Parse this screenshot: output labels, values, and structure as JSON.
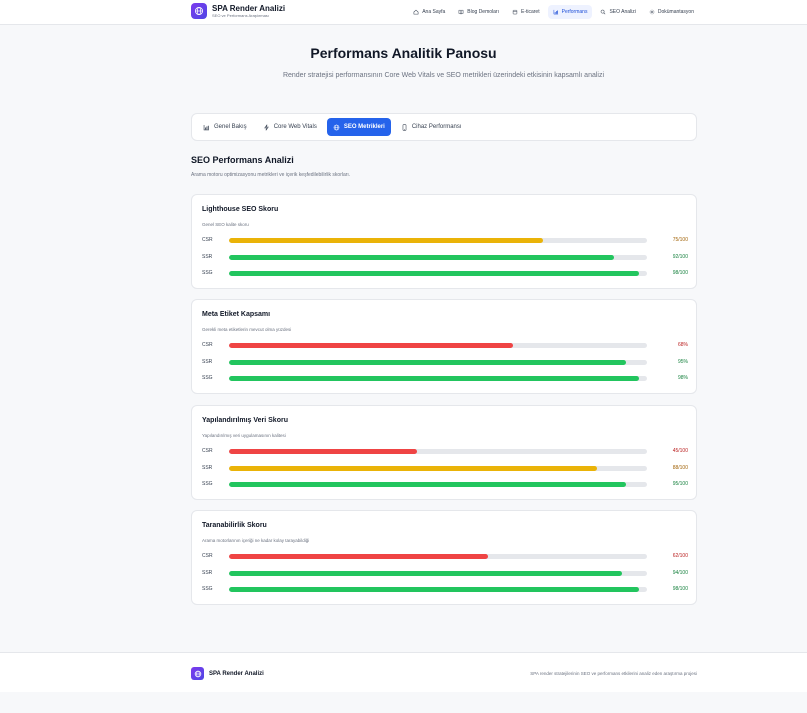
{
  "header": {
    "brand_title": "SPA Render Analizi",
    "brand_subtitle": "SEO ve Performans Araştırması",
    "logo_icon": "globe-icon",
    "nav": [
      {
        "label": "Ana Sayfa",
        "icon": "home-icon",
        "active": false
      },
      {
        "label": "Blog Demoları",
        "icon": "book-icon",
        "active": false
      },
      {
        "label": "E-ticaret",
        "icon": "store-icon",
        "active": false
      },
      {
        "label": "Performans",
        "icon": "chart-icon",
        "active": true
      },
      {
        "label": "SEO Analizi",
        "icon": "search-icon",
        "active": false
      },
      {
        "label": "Dokümantasyon",
        "icon": "gear-icon",
        "active": false
      }
    ]
  },
  "page": {
    "title": "Performans Analitik Panosu",
    "subtitle": "Render stratejisi performansının Core Web Vitals ve SEO metrikleri üzerindeki etkisinin kapsamlı analizi"
  },
  "tabs": [
    {
      "label": "Genel Bakış",
      "icon": "bar-chart-icon",
      "active": false
    },
    {
      "label": "Core Web Vitals",
      "icon": "lightning-icon",
      "active": false
    },
    {
      "label": "SEO Metrikleri",
      "icon": "globe-icon",
      "active": true
    },
    {
      "label": "Cihaz Performansı",
      "icon": "mobile-icon",
      "active": false
    }
  ],
  "section": {
    "title": "SEO Performans Analizi",
    "description": "Arama motoru optimizasyonu metrikleri ve içerik keşfedilebilirlik skorları."
  },
  "colors": {
    "green": "#22c55e",
    "yellow": "#eab308",
    "red": "#ef4444",
    "green_text": "#15803d",
    "yellow_text": "#a16207",
    "red_text": "#b91c1c"
  },
  "cards": [
    {
      "title": "Lighthouse SEO Skoru",
      "description": "Genel SEO kalite skoru",
      "rows": [
        {
          "label": "CSR",
          "value": 75,
          "display": "75/100",
          "status": "yellow"
        },
        {
          "label": "SSR",
          "value": 92,
          "display": "92/100",
          "status": "green"
        },
        {
          "label": "SSG",
          "value": 98,
          "display": "98/100",
          "status": "green"
        }
      ]
    },
    {
      "title": "Meta Etiket Kapsamı",
      "description": "Gerekli meta etiketlerin mevcut olma yüzdesi",
      "rows": [
        {
          "label": "CSR",
          "value": 68,
          "display": "68%",
          "status": "red"
        },
        {
          "label": "SSR",
          "value": 95,
          "display": "95%",
          "status": "green"
        },
        {
          "label": "SSG",
          "value": 98,
          "display": "98%",
          "status": "green"
        }
      ]
    },
    {
      "title": "Yapılandırılmış Veri Skoru",
      "description": "Yapılandırılmış veri uygulamasının kalitesi",
      "rows": [
        {
          "label": "CSR",
          "value": 45,
          "display": "45/100",
          "status": "red"
        },
        {
          "label": "SSR",
          "value": 88,
          "display": "88/100",
          "status": "yellow"
        },
        {
          "label": "SSG",
          "value": 95,
          "display": "95/100",
          "status": "green"
        }
      ]
    },
    {
      "title": "Taranabilirlik Skoru",
      "description": "Arama motorlarının içeriği ne kadar kolay tarayabildiği",
      "rows": [
        {
          "label": "CSR",
          "value": 62,
          "display": "62/100",
          "status": "red"
        },
        {
          "label": "SSR",
          "value": 94,
          "display": "94/100",
          "status": "green"
        },
        {
          "label": "SSG",
          "value": 98,
          "display": "98/100",
          "status": "green"
        }
      ]
    }
  ],
  "footer": {
    "title": "SPA Render Analizi",
    "description": "SPA render stratejilerinin SEO ve performans etkilerini analiz eden araştırma projesi"
  }
}
